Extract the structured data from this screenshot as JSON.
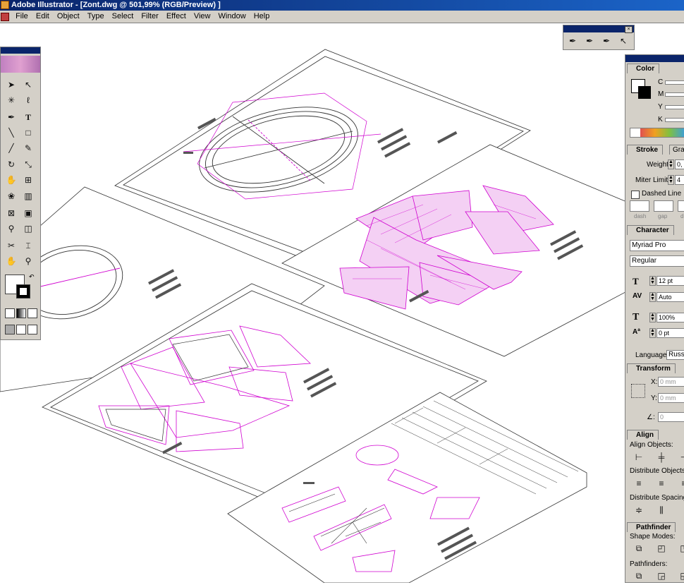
{
  "window": {
    "title": "Adobe Illustrator - [Zont.dwg @ 501,99% (RGB/Preview) ]"
  },
  "menu": [
    {
      "label": "File",
      "u": "F"
    },
    {
      "label": "Edit",
      "u": "E"
    },
    {
      "label": "Object",
      "u": "O"
    },
    {
      "label": "Type",
      "u": "T"
    },
    {
      "label": "Select",
      "u": "S"
    },
    {
      "label": "Filter",
      "u": "i"
    },
    {
      "label": "Effect",
      "u": "c"
    },
    {
      "label": "View",
      "u": "V"
    },
    {
      "label": "Window",
      "u": "W"
    },
    {
      "label": "Help",
      "u": "H"
    }
  ],
  "toolbox": {
    "icons": [
      "selection-tool",
      "direct-selection-tool",
      "magic-wand-tool",
      "lasso-tool",
      "pen-tool",
      "type-tool",
      "line-tool",
      "rectangle-tool",
      "paintbrush-tool",
      "pencil-tool",
      "rotate-tool",
      "scale-tool",
      "warp-tool",
      "free-transform-tool",
      "symbol-sprayer-tool",
      "column-graph-tool",
      "mesh-tool",
      "gradient-tool",
      "eyedropper-tool",
      "blend-tool",
      "scissors-tool",
      "slice-tool",
      "hand-tool",
      "zoom-tool"
    ]
  },
  "color_panel": {
    "tab": "Color",
    "channels": [
      "C",
      "M",
      "Y",
      "K"
    ]
  },
  "stroke_panel": {
    "tab": "Stroke",
    "tab2": "Gra",
    "weight_label": "Weight:",
    "weight_value": "0,",
    "miter_label": "Miter Limit:",
    "miter_value": "4",
    "dashed_label": "Dashed Line",
    "dash_labels": [
      "dash",
      "gap",
      "d"
    ]
  },
  "character_panel": {
    "tab": "Character",
    "font": "Myriad Pro",
    "style": "Regular",
    "size": "12 pt",
    "leading": "Auto",
    "scale": "100%",
    "baseline": "0 pt",
    "language_label": "Language:",
    "language_value": "Russ"
  },
  "transform_panel": {
    "tab": "Transform",
    "x_label": "X:",
    "x_value": "0 mm",
    "y_label": "Y:",
    "y_value": "0 mm",
    "angle_label": "∠:",
    "angle_value": "0"
  },
  "align_panel": {
    "tab": "Align",
    "align_objects": "Align Objects:",
    "distribute_objects": "Distribute Objects:",
    "distribute_spacing": "Distribute Spacing:"
  },
  "pathfinder_panel": {
    "tab": "Pathfinder",
    "shape_modes": "Shape Modes:",
    "pathfinders": "Pathfinders:"
  },
  "accent": {
    "titlebar": "#0a246a",
    "magenta": "#d000d0",
    "panel": "#d4d0c8"
  }
}
